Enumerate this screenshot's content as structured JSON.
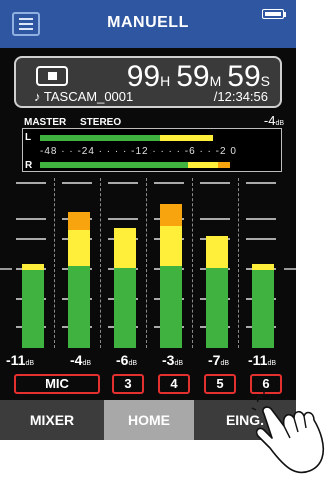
{
  "header": {
    "title": "MANUELL",
    "menu_icon": "hamburger-menu-icon",
    "battery_icon": "battery-icon"
  },
  "transport": {
    "stop_icon": "stop-icon",
    "hours": "99",
    "hours_unit": "H",
    "minutes": "59",
    "minutes_unit": "M",
    "seconds": "59",
    "seconds_unit": "S",
    "file_icon": "music-note-icon",
    "file_name": "TASCAM_0001",
    "total_time": "/12:34:56"
  },
  "master": {
    "label": "MASTER",
    "mode": "STEREO",
    "level_value": "-4",
    "level_unit": "dB",
    "channel_l": "L",
    "channel_r": "R",
    "scale": "-48 · · -24 · · · · -12 · · · · -6 · · -2 0",
    "meter_l": {
      "green": 0.57,
      "yellow": 0.25
    },
    "meter_r": {
      "green": 0.7,
      "yellow": 0.14,
      "orange": 0.06
    }
  },
  "channels": [
    {
      "value": "-11",
      "unit": "dB",
      "source": "MIC"
    },
    {
      "value": "-4",
      "unit": "dB",
      "source": ""
    },
    {
      "value": "-6",
      "unit": "dB",
      "source": "3"
    },
    {
      "value": "-3",
      "unit": "dB",
      "source": "4"
    },
    {
      "value": "-7",
      "unit": "dB",
      "source": "5"
    },
    {
      "value": "-11",
      "unit": "dB",
      "source": "6"
    }
  ],
  "tabs": {
    "mixer": "MIXER",
    "home": "HOME",
    "input": "EING."
  },
  "colors": {
    "header": "#2f56a0",
    "green": "#3fb23f",
    "yellow": "#ffee3a",
    "orange": "#f7a40f",
    "source_border": "#e53030"
  }
}
